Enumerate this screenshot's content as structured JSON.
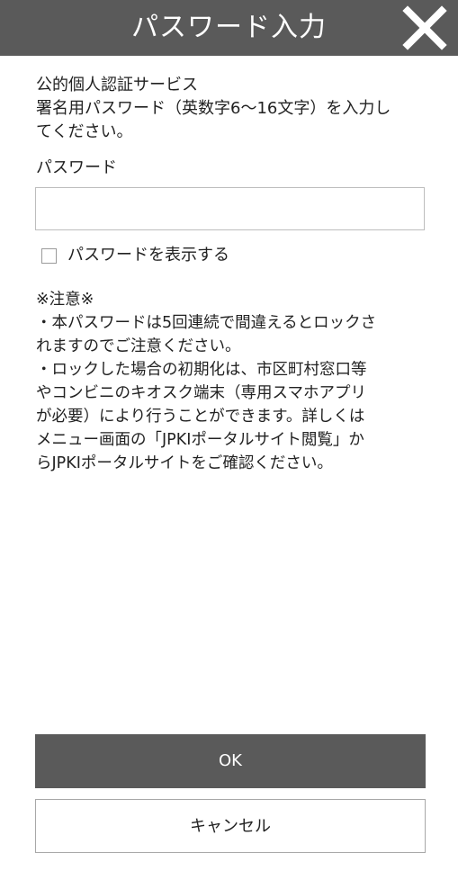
{
  "header": {
    "title": "パスワード入力",
    "close_icon": "close-icon",
    "background_color": "#5a5a5a"
  },
  "intro": {
    "line1": "公的個人認証サービス",
    "line2": "署名用パスワード（英数字6〜16文字）を入力し",
    "line3": "てください。"
  },
  "password": {
    "label": "パスワード",
    "value": "",
    "placeholder": ""
  },
  "show_password": {
    "label": "パスワードを表示する",
    "checked": false
  },
  "notice": {
    "heading": "※注意※",
    "lines": [
      "・本パスワードは5回連続で間違えるとロックさ",
      "れますのでご注意ください。",
      "・ロックした場合の初期化は、市区町村窓口等",
      "やコンビニのキオスク端末（専用スマホアプリ",
      "が必要）により行うことができます。詳しくは",
      "メニュー画面の「JPKIポータルサイト閲覧」か",
      "らJPKIポータルサイトをご確認ください。"
    ]
  },
  "buttons": {
    "ok_label": "OK",
    "cancel_label": "キャンセル",
    "primary_color": "#5a5a5a"
  }
}
